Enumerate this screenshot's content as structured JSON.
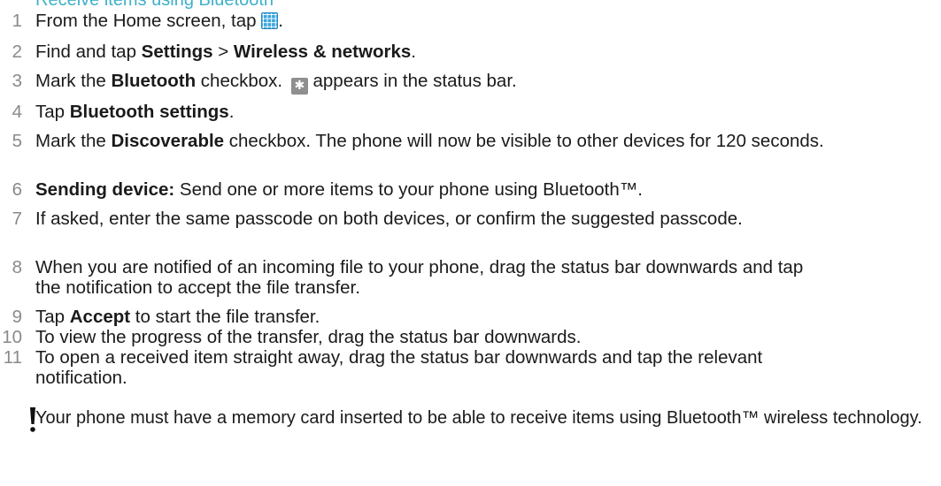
{
  "heading": "Receive items using Bluetooth",
  "steps": [
    {
      "num": "1",
      "parts": [
        "From the Home screen, tap ",
        "."
      ]
    },
    {
      "num": "2",
      "parts": [
        "Find and tap ",
        "Settings",
        " > ",
        "Wireless & networks",
        "."
      ]
    },
    {
      "num": "3",
      "parts": [
        "Mark the ",
        "Bluetooth",
        " checkbox. ",
        " appears in the status bar."
      ]
    },
    {
      "num": "4",
      "parts": [
        "Tap ",
        "Bluetooth settings",
        "."
      ]
    },
    {
      "num": "5",
      "parts": [
        "Mark the ",
        "Discoverable",
        " checkbox. The phone will now be visible to other devices for 120 seconds."
      ]
    },
    {
      "num": "6",
      "parts": [
        "Sending device:",
        " Send one or more items to your phone using Bluetooth™."
      ]
    },
    {
      "num": "7",
      "parts": [
        "If asked, enter the same passcode on both devices, or confirm the suggested passcode."
      ]
    },
    {
      "num": "8",
      "parts": [
        "When you are notified of an incoming file to your phone, drag the status bar downwards and tap the notification to accept the file transfer."
      ]
    },
    {
      "num": "9",
      "parts": [
        "Tap ",
        "Accept",
        " to start the file transfer."
      ]
    },
    {
      "num": "10",
      "parts": [
        "To view the progress of the transfer, drag the status bar downwards."
      ]
    },
    {
      "num": "11",
      "parts": [
        "To open a received item straight away, drag the status bar downwards and tap the relevant notification."
      ]
    }
  ],
  "icons": {
    "apps": "apps-grid-icon",
    "bluetooth": "bluetooth-status-icon",
    "bluetooth_glyph": "✱",
    "note": "exclamation-note-icon",
    "apps_color": "#3aa6e0",
    "heading_color": "#3fb0c9"
  },
  "note": "Your phone must have a memory card inserted to be able to receive items using Bluetooth™ wireless technology."
}
